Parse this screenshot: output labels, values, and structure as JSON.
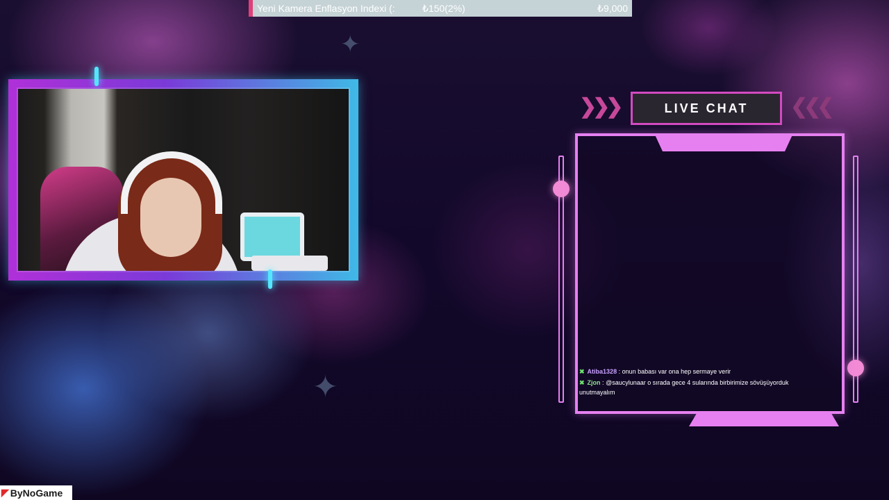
{
  "ticker": {
    "title": "Yeni Kamera Enflasyon Indexi (:",
    "delta": "₺150(2%)",
    "total": "₺9,000"
  },
  "chat": {
    "header": "LIVE CHAT",
    "messages": [
      {
        "user": "Atiba1328",
        "user_color": "#c9a0ff",
        "text": "onun babası var ona hep sermaye verir"
      },
      {
        "user": "Zjon",
        "user_color": "#8fe08f",
        "text": "@saucylunaar o sırada gece 4 sularında birbirimize sövüşüyorduk unutmayalım"
      }
    ]
  },
  "watermark": {
    "mark": "◤",
    "text": "ByNoGame"
  },
  "colors": {
    "accent_pink": "#e680f0",
    "accent_cyan": "#3fb9e6",
    "ticker_marker": "#e0407a"
  }
}
